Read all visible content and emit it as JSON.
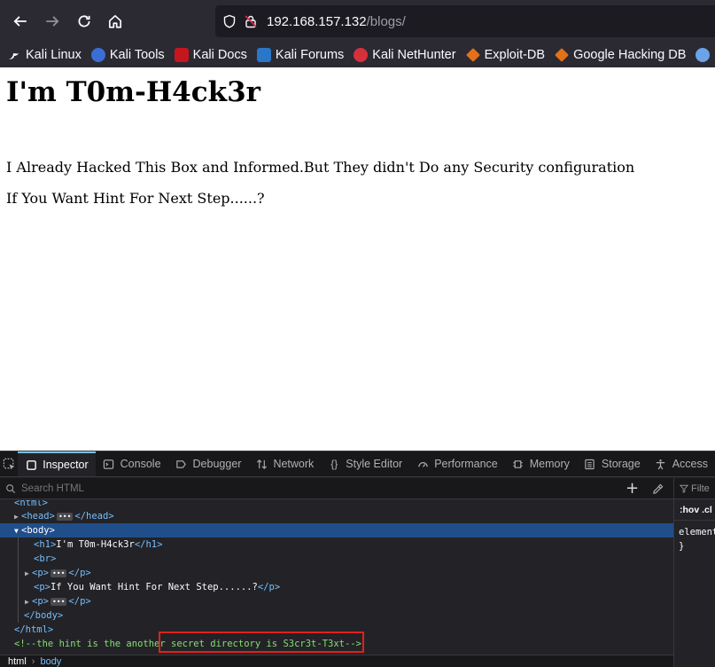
{
  "browser": {
    "url_host": "192.168.157.132",
    "url_path": "/blogs/",
    "bookmarks": [
      {
        "label": "Kali Linux",
        "icon": "kali-dragon-icon",
        "color": "#2b2a33"
      },
      {
        "label": "Kali Tools",
        "icon": "kali-tools-icon",
        "color": "#3b6ed5"
      },
      {
        "label": "Kali Docs",
        "icon": "kali-docs-icon",
        "color": "#c4161c"
      },
      {
        "label": "Kali Forums",
        "icon": "kali-forums-icon",
        "color": "#2a76c8"
      },
      {
        "label": "Kali NetHunter",
        "icon": "nethunter-icon",
        "color": "#d6313a"
      },
      {
        "label": "Exploit-DB",
        "icon": "exploitdb-icon",
        "color": "#e3711a"
      },
      {
        "label": "Google Hacking DB",
        "icon": "ghdb-icon",
        "color": "#e3711a"
      }
    ]
  },
  "page": {
    "heading": "I'm T0m-H4ck3r",
    "paragraph1": "I Already Hacked This Box and Informed.But They didn't Do any Security configuration",
    "paragraph2": "If You Want Hint For Next Step......?"
  },
  "devtools": {
    "tabs": [
      {
        "label": "Inspector",
        "icon": "inspector-icon",
        "active": true
      },
      {
        "label": "Console",
        "icon": "console-icon"
      },
      {
        "label": "Debugger",
        "icon": "debugger-icon"
      },
      {
        "label": "Network",
        "icon": "network-icon"
      },
      {
        "label": "Style Editor",
        "icon": "style-editor-icon"
      },
      {
        "label": "Performance",
        "icon": "performance-icon"
      },
      {
        "label": "Memory",
        "icon": "memory-icon"
      },
      {
        "label": "Storage",
        "icon": "storage-icon"
      },
      {
        "label": "Access",
        "icon": "accessibility-icon"
      }
    ],
    "search_placeholder": "Search HTML",
    "tree": {
      "html_open": "<html>",
      "head": [
        "<head>",
        "</head>"
      ],
      "body_open": "<body>",
      "h1": [
        "<h1>",
        "I'm T0m-H4ck3r",
        "</h1>"
      ],
      "br": "<br>",
      "p_collapsed_1": [
        "<p>",
        "</p>"
      ],
      "p_hint": [
        "<p>",
        "If You Want Hint For Next Step......?",
        "</p>"
      ],
      "p_collapsed_2": [
        "<p>",
        "</p>"
      ],
      "body_close": "</body>",
      "html_close": "</html>",
      "comment_a": "<!--the hint is the another ",
      "comment_b": "secret directory is S3cr3t-T3xt-->"
    },
    "breadcrumb": [
      "html",
      "body"
    ],
    "rules": {
      "filter": "Filte",
      "hov": ":hov  .cl",
      "element": "element",
      "close_brace": "}"
    }
  },
  "colors": {
    "chrome_bg": "#2b2a33",
    "selection": "#204e8a",
    "tag": "#75bfff",
    "comment": "#86de74",
    "highlight_box": "#e0201c"
  }
}
